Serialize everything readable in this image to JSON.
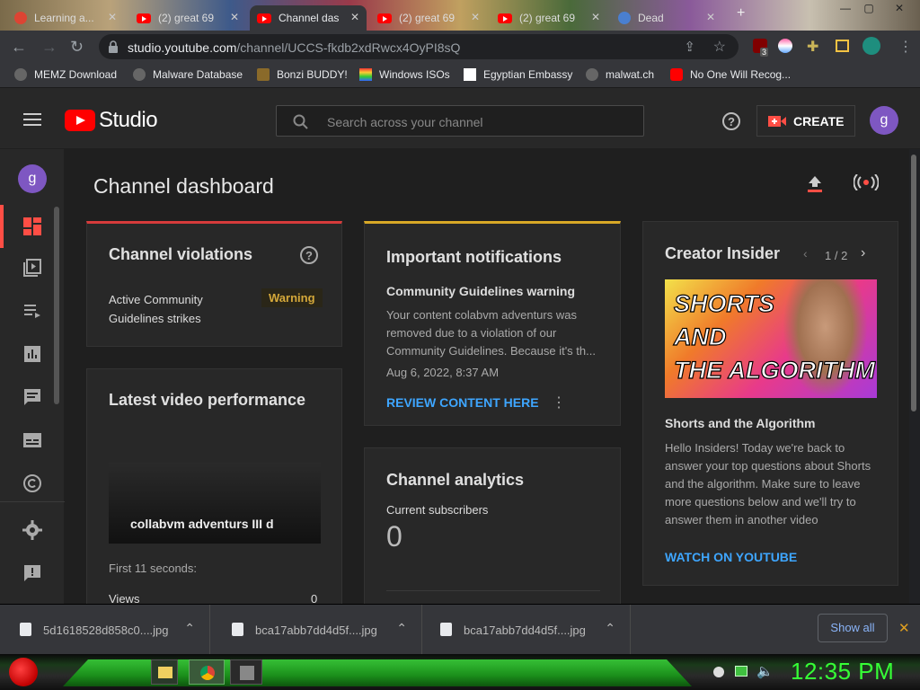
{
  "browser": {
    "tabs": [
      {
        "title": "Learning a..."
      },
      {
        "title": "(2) great 69"
      },
      {
        "title": "Channel das"
      },
      {
        "title": "(2) great 69"
      },
      {
        "title": "(2) great 69"
      },
      {
        "title": "Dead"
      }
    ],
    "url_domain": "studio.youtube.com",
    "url_path": "/channel/UCCS-fkdb2xdRwcx4OyPI8sQ",
    "extension_badge": "3",
    "bookmarks": [
      {
        "label": "MEMZ Download"
      },
      {
        "label": "Malware Database"
      },
      {
        "label": "Bonzi BUDDY!"
      },
      {
        "label": "Windows ISOs"
      },
      {
        "label": "Egyptian Embassy"
      },
      {
        "label": "malwat.ch"
      },
      {
        "label": "No One Will Recog..."
      }
    ]
  },
  "studio": {
    "logo_text": "Studio",
    "search_placeholder": "Search across your channel",
    "create_label": "CREATE",
    "avatar_letter": "g"
  },
  "dashboard": {
    "title": "Channel dashboard",
    "violations": {
      "title": "Channel violations",
      "strikes_label": "Active Community Guidelines strikes",
      "status": "Warning"
    },
    "latest_video": {
      "title": "Latest video performance",
      "video_title": "collabvm adventurs III d",
      "period": "First 11 seconds:",
      "metric_label": "Views",
      "metric_value": "0"
    },
    "notifications": {
      "title": "Important notifications",
      "heading": "Community Guidelines warning",
      "body": "Your content colabvm adventurs was removed due to a violation of our Community Guidelines. Because it's th...",
      "date": "Aug 6, 2022, 8:37 AM",
      "action": "REVIEW CONTENT HERE"
    },
    "analytics": {
      "title": "Channel analytics",
      "subs_label": "Current subscribers",
      "subs_value": "0"
    },
    "creator_insider": {
      "title": "Creator Insider",
      "pager": "1 / 2",
      "thumb_text_line1": "SHORTS",
      "thumb_text_line2": "AND",
      "thumb_text_line3": "THE ALGORITHM",
      "video_title": "Shorts and the Algorithm",
      "description": "Hello Insiders! Today we're back to answer your top questions about Shorts and the algorithm. Make sure to leave more questions below and we'll try to answer them in another video",
      "action": "WATCH ON YOUTUBE"
    }
  },
  "downloads": {
    "items": [
      {
        "name": "5d1618528d858c0....jpg"
      },
      {
        "name": "bca17abb7dd4d5f....jpg"
      },
      {
        "name": "bca17abb7dd4d5f....jpg"
      }
    ],
    "show_all": "Show all"
  },
  "taskbar": {
    "clock": "12:35 PM"
  },
  "colors": {
    "youtube_red": "#ff0000",
    "link_blue": "#3ea6ff",
    "warning_yellow": "#e0b040",
    "avatar_purple": "#7e57c2",
    "clock_green": "#36ff36"
  }
}
